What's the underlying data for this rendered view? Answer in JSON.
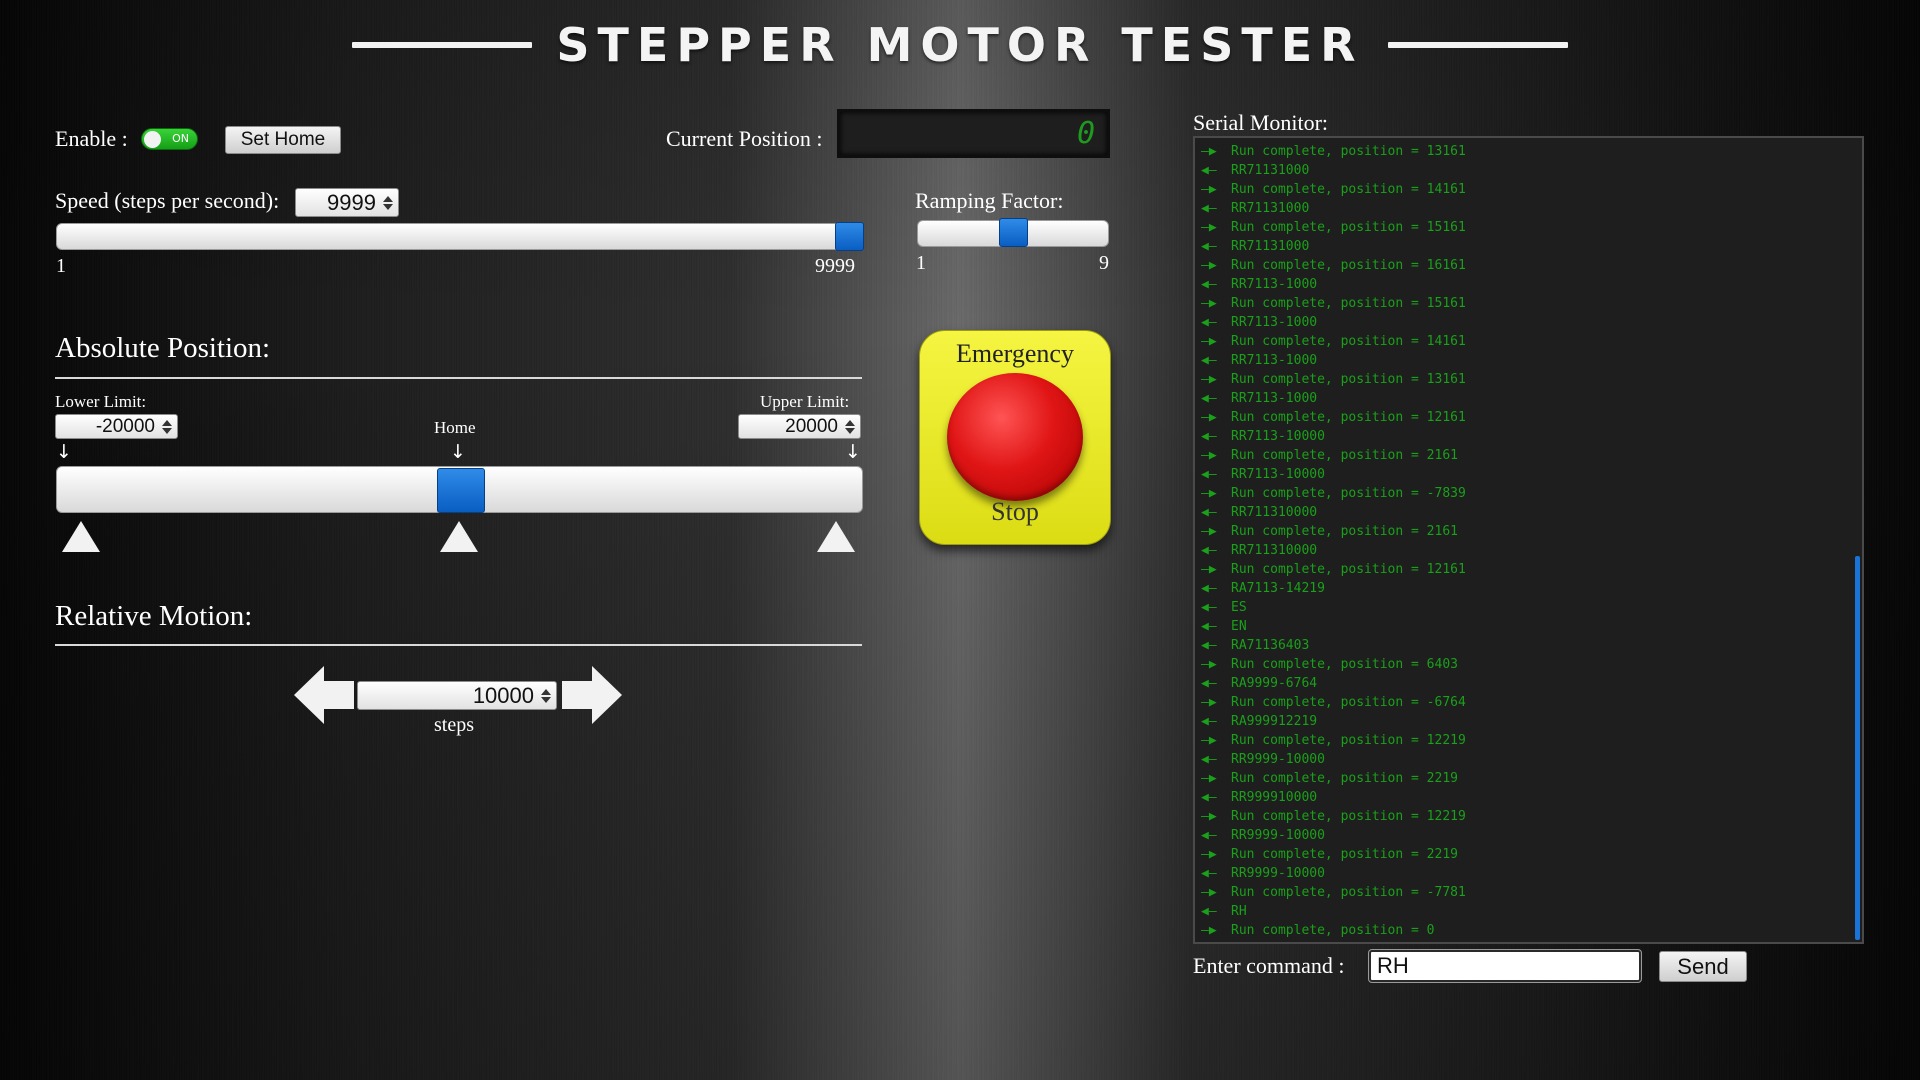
{
  "title": "STEPPER MOTOR TESTER",
  "controls": {
    "enable_label": "Enable :",
    "toggle_text": "ON",
    "set_home_label": "Set Home",
    "current_position_label": "Current Position :",
    "current_position_value": "0"
  },
  "speed": {
    "label": "Speed (steps per second):",
    "value": "9999",
    "min_label": "1",
    "max_label": "9999",
    "min": 1,
    "max": 9999
  },
  "ramping": {
    "label": "Ramping Factor:",
    "min_label": "1",
    "max_label": "9",
    "value": 5
  },
  "absolute": {
    "title": "Absolute Position:",
    "lower_limit_label": "Lower Limit:",
    "lower_limit_value": "-20000",
    "upper_limit_label": "Upper Limit:",
    "upper_limit_value": "20000",
    "home_label": "Home",
    "position_value": 0
  },
  "relative": {
    "title": "Relative Motion:",
    "steps_value": "10000",
    "steps_label": "steps"
  },
  "emergency": {
    "top_label": "Emergency",
    "bottom_label": "Stop"
  },
  "serial": {
    "title": "Serial Monitor:",
    "lines": [
      {
        "dir": "in",
        "text": "Run complete, position = 13161"
      },
      {
        "dir": "out",
        "text": "RR71131000"
      },
      {
        "dir": "in",
        "text": "Run complete, position = 14161"
      },
      {
        "dir": "out",
        "text": "RR71131000"
      },
      {
        "dir": "in",
        "text": "Run complete, position = 15161"
      },
      {
        "dir": "out",
        "text": "RR71131000"
      },
      {
        "dir": "in",
        "text": "Run complete, position = 16161"
      },
      {
        "dir": "out",
        "text": "RR7113-1000"
      },
      {
        "dir": "in",
        "text": "Run complete, position = 15161"
      },
      {
        "dir": "out",
        "text": "RR7113-1000"
      },
      {
        "dir": "in",
        "text": "Run complete, position = 14161"
      },
      {
        "dir": "out",
        "text": "RR7113-1000"
      },
      {
        "dir": "in",
        "text": "Run complete, position = 13161"
      },
      {
        "dir": "out",
        "text": "RR7113-1000"
      },
      {
        "dir": "in",
        "text": "Run complete, position = 12161"
      },
      {
        "dir": "out",
        "text": "RR7113-10000"
      },
      {
        "dir": "in",
        "text": "Run complete, position = 2161"
      },
      {
        "dir": "out",
        "text": "RR7113-10000"
      },
      {
        "dir": "in",
        "text": "Run complete, position = -7839"
      },
      {
        "dir": "out",
        "text": "RR711310000"
      },
      {
        "dir": "in",
        "text": "Run complete, position = 2161"
      },
      {
        "dir": "out",
        "text": "RR711310000"
      },
      {
        "dir": "in",
        "text": "Run complete, position = 12161"
      },
      {
        "dir": "out",
        "text": "RA7113-14219"
      },
      {
        "dir": "out",
        "text": "ES"
      },
      {
        "dir": "out",
        "text": "EN"
      },
      {
        "dir": "out",
        "text": "RA71136403"
      },
      {
        "dir": "in",
        "text": "Run complete, position = 6403"
      },
      {
        "dir": "out",
        "text": "RA9999-6764"
      },
      {
        "dir": "in",
        "text": "Run complete, position = -6764"
      },
      {
        "dir": "out",
        "text": "RA999912219"
      },
      {
        "dir": "in",
        "text": "Run complete, position = 12219"
      },
      {
        "dir": "out",
        "text": "RR9999-10000"
      },
      {
        "dir": "in",
        "text": "Run complete, position = 2219"
      },
      {
        "dir": "out",
        "text": "RR999910000"
      },
      {
        "dir": "in",
        "text": "Run complete, position = 12219"
      },
      {
        "dir": "out",
        "text": "RR9999-10000"
      },
      {
        "dir": "in",
        "text": "Run complete, position = 2219"
      },
      {
        "dir": "out",
        "text": "RR9999-10000"
      },
      {
        "dir": "in",
        "text": "Run complete, position = -7781"
      },
      {
        "dir": "out",
        "text": "RH"
      },
      {
        "dir": "in",
        "text": "Run complete, position = 0"
      }
    ]
  },
  "command": {
    "label": "Enter command :",
    "value": "RH",
    "send_label": "Send"
  },
  "colors": {
    "accent_blue": "#0a6fd6",
    "log_green": "#1aa01a",
    "toggle_green": "#2fc02f",
    "estop_yellow": "#e9e91f",
    "estop_red": "#e01515"
  }
}
